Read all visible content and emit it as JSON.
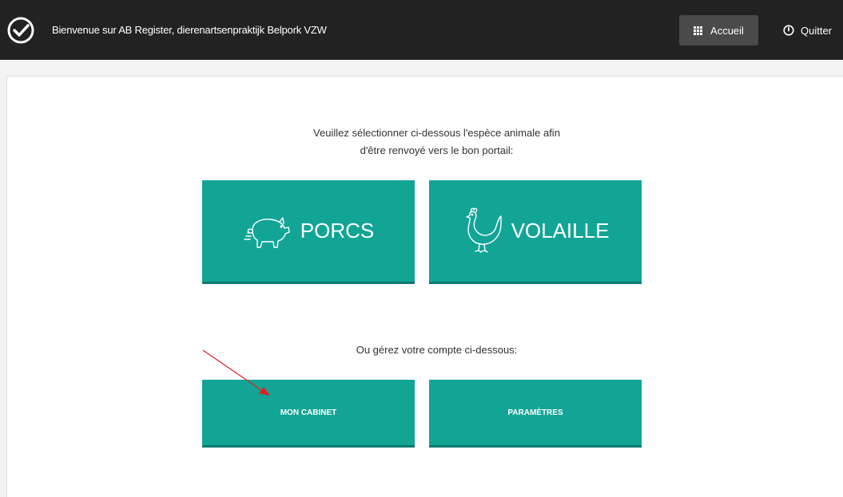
{
  "header": {
    "welcome_text": "Bienvenue sur AB Register, dierenartsenpraktijk Belpork VZW",
    "home_label": "Accueil",
    "quit_label": "Quitter",
    "logo_icon": "check-circle-icon"
  },
  "main": {
    "intro_line1": "Veuillez sélectionner ci-dessous l'espèce animale afin",
    "intro_line2": "d'être renvoyé vers le bon portail:",
    "species": [
      {
        "label": "PORCS",
        "icon": "pig-icon"
      },
      {
        "label": "VOLAILLE",
        "icon": "chicken-icon"
      }
    ],
    "account_intro": "Ou gérez votre compte ci-dessous:",
    "account_buttons": [
      {
        "label": "MON CABINET"
      },
      {
        "label": "PARAMÈTRES"
      }
    ]
  },
  "colors": {
    "topbar": "#222222",
    "tile": "#12a596",
    "tile_shadow": "#0b7a6f",
    "annotation_arrow": "#e02020"
  }
}
